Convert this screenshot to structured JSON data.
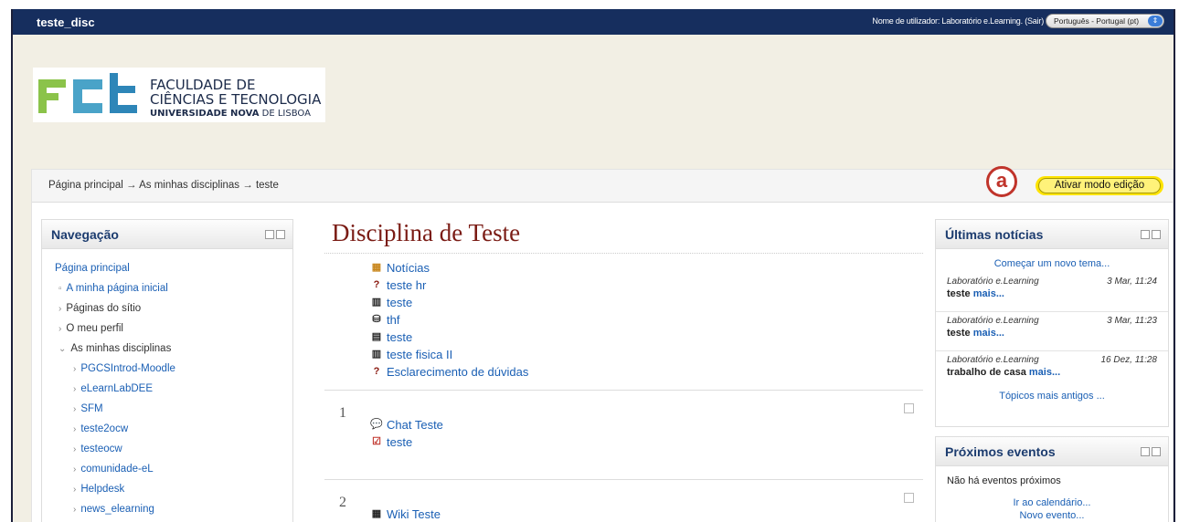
{
  "topbar": {
    "site_name": "teste_disc",
    "login_text": "Nome de utilizador: Laboratório e.Learning. (Sair)",
    "language": "Português - Portugal (pt)"
  },
  "logo": {
    "line1": "FACULDADE DE",
    "line2": "CIÊNCIAS E TECNOLOGIA",
    "line3_bold": "UNIVERSIDADE NOVA",
    "line3_rest": " DE LISBOA"
  },
  "breadcrumb": {
    "items": [
      "Página principal",
      "As minhas disciplinas",
      "teste"
    ],
    "separator": "→"
  },
  "edit_button": "Ativar modo edição",
  "marker_label": "a",
  "navigation": {
    "title": "Navegação",
    "items": [
      "Página principal",
      "A minha página inicial",
      "Páginas do sítio",
      "O meu perfil",
      "As minhas disciplinas",
      "PGCSIntrod-Moodle",
      "eLearnLabDEE",
      "SFM",
      "teste2ocw",
      "testeocw",
      "comunidade-eL",
      "Helpdesk",
      "news_elearning"
    ]
  },
  "course": {
    "title": "Disciplina de Teste",
    "activities": [
      {
        "icon": "forum-icon",
        "label": "Notícias"
      },
      {
        "icon": "question-icon",
        "label": "teste hr"
      },
      {
        "icon": "glossary-icon",
        "label": "teste"
      },
      {
        "icon": "database-icon",
        "label": "thf"
      },
      {
        "icon": "page-icon",
        "label": "teste"
      },
      {
        "icon": "glossary-icon",
        "label": "teste fisica II"
      },
      {
        "icon": "question-icon",
        "label": "Esclarecimento de dúvidas"
      }
    ],
    "sections": [
      {
        "number": "1",
        "items": [
          {
            "icon": "chat-icon",
            "label": "Chat Teste"
          },
          {
            "icon": "quiz-icon",
            "label": "teste"
          }
        ]
      },
      {
        "number": "2",
        "items": [
          {
            "icon": "wiki-icon",
            "label": "Wiki Teste"
          }
        ]
      }
    ]
  },
  "news": {
    "title": "Últimas notícias",
    "new_topic": "Começar um novo tema...",
    "items": [
      {
        "author": "Laboratório e.Learning",
        "date": "3 Mar, 11:24",
        "text": "teste",
        "more": "mais..."
      },
      {
        "author": "Laboratório e.Learning",
        "date": "3 Mar, 11:23",
        "text": "teste",
        "more": "mais..."
      },
      {
        "author": "Laboratório e.Learning",
        "date": "16 Dez, 11:28",
        "text": "trabalho de casa",
        "more": "mais..."
      }
    ],
    "older": "Tópicos mais antigos ..."
  },
  "events": {
    "title": "Próximos eventos",
    "empty": "Não há eventos próximos",
    "calendar_link": "Ir ao calendário...",
    "new_event": "Novo evento..."
  },
  "colors": {
    "topbar": "#162e5e",
    "link": "#1a5fb4",
    "course_title": "#7a1b14",
    "highlight": "#ffe400",
    "marker": "#c0342b"
  }
}
